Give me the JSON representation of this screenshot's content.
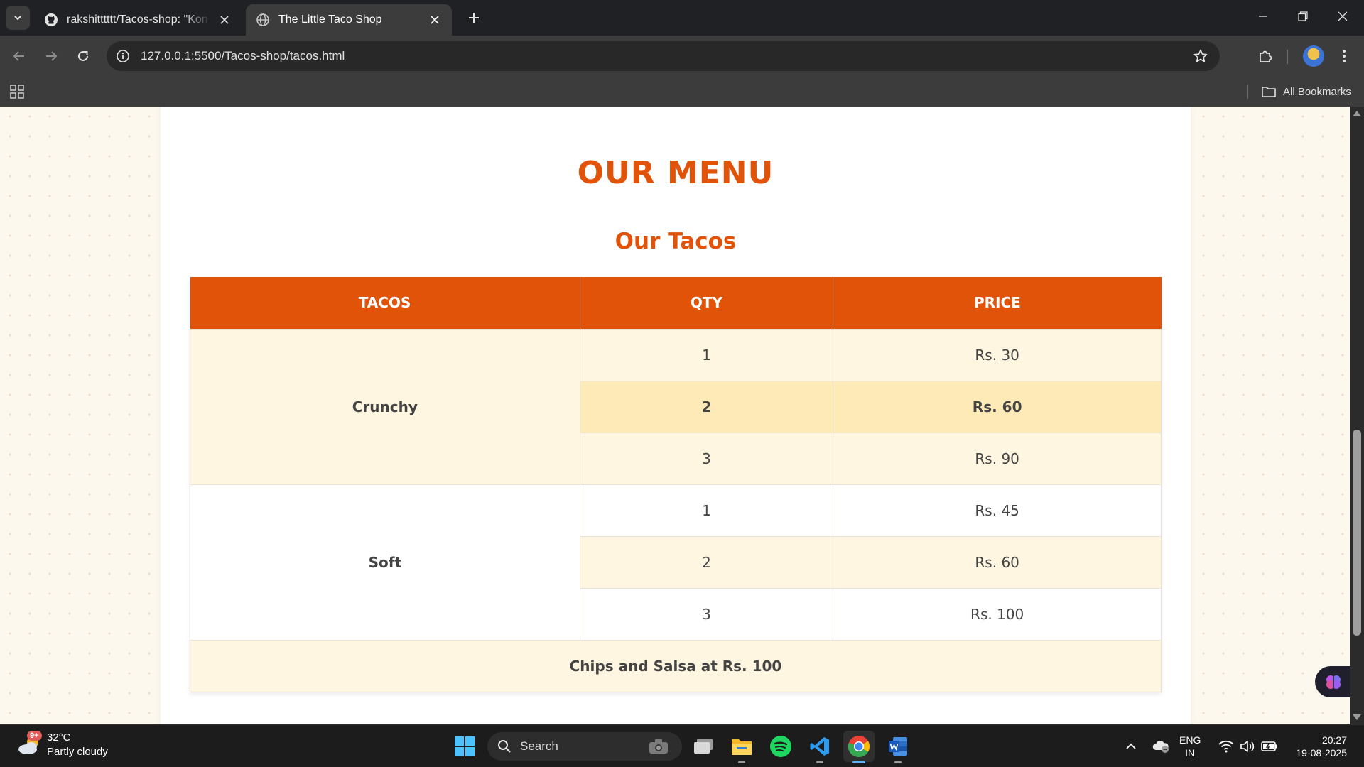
{
  "browser": {
    "tabs": [
      {
        "title": "rakshitttttt/Tacos-shop: \"Kon hai",
        "icon": "github-icon",
        "active": false
      },
      {
        "title": "The Little Taco Shop",
        "icon": "globe-icon",
        "active": true
      }
    ],
    "url": "127.0.0.1:5500/Tacos-shop/tacos.html",
    "bookmarks_label": "All Bookmarks"
  },
  "page": {
    "heading": "OUR MENU",
    "subheading": "Our Tacos",
    "table": {
      "headers": [
        "TACOS",
        "QTY",
        "PRICE"
      ],
      "groups": [
        {
          "name": "Crunchy",
          "rows": [
            {
              "qty": "1",
              "price": "Rs. 30"
            },
            {
              "qty": "2",
              "price": "Rs. 60",
              "highlighted": true
            },
            {
              "qty": "3",
              "price": "Rs. 90"
            }
          ]
        },
        {
          "name": "Soft",
          "rows": [
            {
              "qty": "1",
              "price": "Rs. 45"
            },
            {
              "qty": "2",
              "price": "Rs. 60"
            },
            {
              "qty": "3",
              "price": "Rs. 100"
            }
          ]
        }
      ],
      "footer": "Chips and Salsa at Rs. 100"
    },
    "colors": {
      "accent": "#e2530a",
      "row_cream": "#fef6e0",
      "row_highlight": "#feeab6"
    }
  },
  "taskbar": {
    "weather": {
      "temp": "32°C",
      "condition": "Partly cloudy",
      "badge": "9+"
    },
    "search_label": "Search",
    "apps": [
      "task-view-icon",
      "file-explorer-icon",
      "spotify-icon",
      "vscode-icon",
      "chrome-icon",
      "word-icon"
    ],
    "language": {
      "line1": "ENG",
      "line2": "IN"
    },
    "time": "20:27",
    "date": "19-08-2025"
  }
}
